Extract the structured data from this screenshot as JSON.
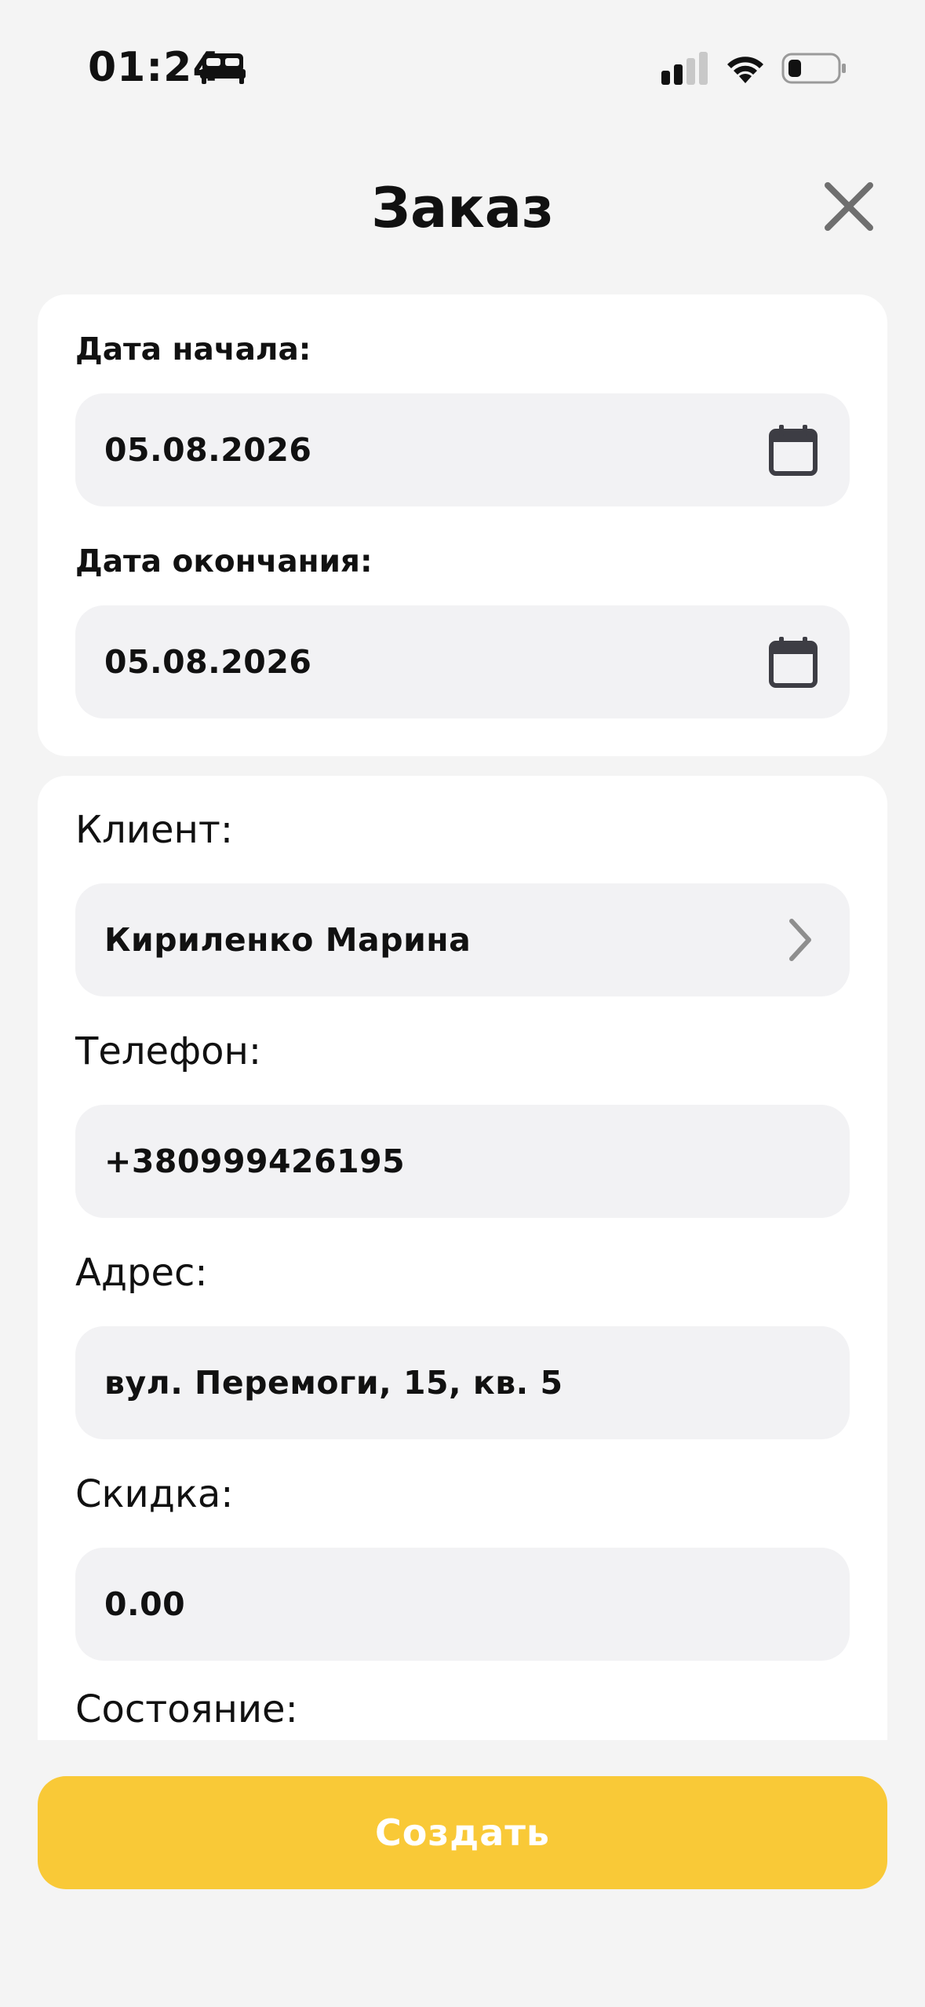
{
  "status_bar": {
    "time": "01:24",
    "icons": [
      "bed-icon",
      "signal-icon",
      "wifi-icon",
      "battery-icon"
    ]
  },
  "header": {
    "title": "Заказ",
    "close_icon": "close-icon"
  },
  "dates": {
    "start_label": "Дата начала:",
    "start_value": "05.08.2026",
    "end_label": "Дата окончания:",
    "end_value": "05.08.2026",
    "field_icon": "calendar-icon"
  },
  "client_section": {
    "client_label": "Клиент:",
    "client_value": "Кириленко Марина",
    "phone_label": "Телефон:",
    "phone_value": "+380999426195",
    "address_label": "Адрес:",
    "address_value": "вул. Перемоги, 15, кв. 5",
    "discount_label": "Скидка:",
    "discount_value": "0.00",
    "state_label": "Состояние:"
  },
  "actions": {
    "create_label": "Создать"
  },
  "colors": {
    "background": "#f4f4f4",
    "card": "#ffffff",
    "field": "#f2f2f4",
    "accent": "#f9c937",
    "icon": "#3d3d44"
  }
}
